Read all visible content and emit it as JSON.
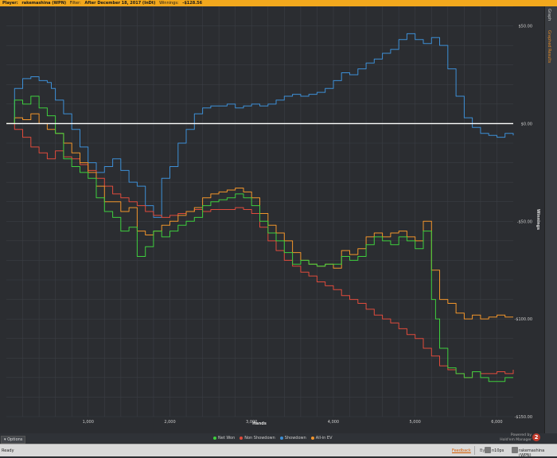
{
  "header": {
    "player_label": "Player:",
    "player_value": "rakemashina (WPN)",
    "filter_label": "Filter:",
    "filter_value": "After December 18, 2017 (InDt)",
    "winnings_label": "Winnings:",
    "winnings_value": "-$128.56"
  },
  "right_panel": {
    "tab1": "Graph",
    "tab2": "Graphed Results"
  },
  "options_label": "Options",
  "brand": {
    "line1": "Powered by",
    "line2": "Hold'em Manager",
    "badge": "2"
  },
  "status": {
    "ready": "Ready",
    "feedback": "Feedback",
    "db_label": "By",
    "user1": "n10ps",
    "user2": "rakemashina (WPN)"
  },
  "colors": {
    "net_won": "#3ecf3e",
    "non_showdown": "#e04b3c",
    "showdown": "#3d8fd6",
    "allin_ev": "#f2952b",
    "background": "#2b2d31",
    "grid": "#3b3e44",
    "zero_line": "#ffffff"
  },
  "chart_data": {
    "type": "line",
    "xlabel": "Hands",
    "ylabel": "Winnings",
    "xlim": [
      0,
      6200
    ],
    "ylim": [
      -150,
      60
    ],
    "x_ticks": [
      1000,
      2000,
      3000,
      4000,
      5000,
      6000
    ],
    "x_tick_labels": [
      "1,000",
      "2,000",
      "3,000",
      "4,000",
      "5,000",
      "6,000"
    ],
    "y_ticks": [
      50,
      0,
      -50,
      -100,
      -150
    ],
    "y_tick_labels": [
      "$50.00",
      "$0.00",
      "-$50.00",
      "-$100.00",
      "-$150.00"
    ],
    "grid": true,
    "legend_position": "bottom",
    "series": [
      {
        "name": "Net Won",
        "color": "#3ecf3e",
        "x": [
          0,
          100,
          200,
          300,
          400,
          500,
          600,
          700,
          800,
          900,
          1000,
          1100,
          1200,
          1300,
          1400,
          1500,
          1600,
          1700,
          1800,
          1900,
          2000,
          2100,
          2200,
          2300,
          2400,
          2500,
          2600,
          2700,
          2800,
          2900,
          3000,
          3100,
          3200,
          3300,
          3400,
          3500,
          3600,
          3700,
          3800,
          3900,
          4000,
          4100,
          4200,
          4300,
          4400,
          4500,
          4600,
          4700,
          4800,
          4900,
          5000,
          5100,
          5200,
          5250,
          5300,
          5400,
          5500,
          5600,
          5700,
          5800,
          5900,
          6000,
          6100,
          6200
        ],
        "y": [
          0,
          12,
          10,
          14,
          8,
          4,
          -5,
          -18,
          -22,
          -25,
          -28,
          -38,
          -45,
          -48,
          -55,
          -53,
          -68,
          -63,
          -55,
          -58,
          -55,
          -52,
          -50,
          -48,
          -42,
          -40,
          -39,
          -38,
          -36,
          -38,
          -42,
          -50,
          -56,
          -60,
          -66,
          -72,
          -70,
          -72,
          -73,
          -72,
          -72,
          -68,
          -70,
          -68,
          -62,
          -58,
          -60,
          -62,
          -58,
          -60,
          -64,
          -55,
          -90,
          -100,
          -115,
          -125,
          -128,
          -130,
          -127,
          -130,
          -132,
          -132,
          -130,
          -130
        ]
      },
      {
        "name": "Non Showdown",
        "color": "#e04b3c",
        "x": [
          0,
          100,
          200,
          300,
          400,
          500,
          600,
          700,
          800,
          900,
          1000,
          1100,
          1200,
          1300,
          1400,
          1500,
          1600,
          1700,
          1800,
          1900,
          2000,
          2100,
          2200,
          2300,
          2400,
          2500,
          2600,
          2700,
          2800,
          2900,
          3000,
          3100,
          3200,
          3300,
          3400,
          3500,
          3600,
          3700,
          3800,
          3900,
          4000,
          4100,
          4200,
          4300,
          4400,
          4500,
          4600,
          4700,
          4800,
          4900,
          5000,
          5100,
          5200,
          5300,
          5400,
          5500,
          5600,
          5700,
          5800,
          5900,
          6000,
          6100,
          6200
        ],
        "y": [
          0,
          -3,
          -7,
          -12,
          -15,
          -18,
          -14,
          -17,
          -18,
          -21,
          -24,
          -28,
          -32,
          -36,
          -38,
          -40,
          -42,
          -45,
          -47,
          -48,
          -47,
          -46,
          -45,
          -44,
          -45,
          -44,
          -44,
          -44,
          -43,
          -44,
          -46,
          -53,
          -60,
          -65,
          -70,
          -73,
          -76,
          -78,
          -81,
          -83,
          -85,
          -88,
          -90,
          -92,
          -95,
          -98,
          -100,
          -102,
          -105,
          -108,
          -110,
          -115,
          -119,
          -124,
          -126,
          -128,
          -130,
          -127,
          -128,
          -128,
          -127,
          -128,
          -126
        ]
      },
      {
        "name": "Showdown",
        "color": "#3d8fd6",
        "x": [
          0,
          100,
          200,
          300,
          400,
          500,
          550,
          600,
          700,
          800,
          900,
          1000,
          1100,
          1200,
          1300,
          1400,
          1500,
          1600,
          1700,
          1800,
          1900,
          2000,
          2100,
          2200,
          2300,
          2400,
          2500,
          2600,
          2700,
          2800,
          2900,
          3000,
          3100,
          3200,
          3300,
          3400,
          3500,
          3600,
          3700,
          3800,
          3900,
          4000,
          4100,
          4200,
          4300,
          4400,
          4500,
          4600,
          4700,
          4800,
          4900,
          5000,
          5100,
          5200,
          5300,
          5400,
          5500,
          5600,
          5700,
          5800,
          5900,
          6000,
          6100,
          6200
        ],
        "y": [
          0,
          18,
          23,
          24,
          22,
          21,
          18,
          12,
          5,
          -3,
          -12,
          -20,
          -25,
          -22,
          -18,
          -24,
          -30,
          -32,
          -42,
          -48,
          -28,
          -22,
          -10,
          -3,
          5,
          8,
          9,
          9,
          10,
          8,
          9,
          10,
          9,
          10,
          12,
          14,
          15,
          14,
          15,
          16,
          18,
          22,
          26,
          25,
          28,
          31,
          33,
          36,
          38,
          43,
          46,
          43,
          41,
          44,
          40,
          28,
          14,
          3,
          -2,
          -5,
          -6,
          -7,
          -5,
          -6
        ]
      },
      {
        "name": "All-in EV",
        "color": "#f2952b",
        "x": [
          0,
          100,
          200,
          300,
          400,
          500,
          600,
          700,
          800,
          900,
          1000,
          1100,
          1200,
          1300,
          1400,
          1500,
          1600,
          1700,
          1800,
          1900,
          2000,
          2100,
          2200,
          2300,
          2400,
          2500,
          2600,
          2700,
          2800,
          2900,
          3000,
          3100,
          3200,
          3300,
          3400,
          3500,
          3600,
          3700,
          3800,
          3900,
          4000,
          4100,
          4200,
          4300,
          4400,
          4500,
          4600,
          4700,
          4800,
          4900,
          5000,
          5100,
          5200,
          5300,
          5400,
          5500,
          5600,
          5700,
          5800,
          5900,
          6000,
          6100,
          6200
        ],
        "y": [
          0,
          3,
          2,
          5,
          0,
          -3,
          -5,
          -10,
          -15,
          -20,
          -25,
          -32,
          -40,
          -40,
          -45,
          -43,
          -55,
          -57,
          -55,
          -52,
          -50,
          -47,
          -45,
          -43,
          -38,
          -36,
          -35,
          -34,
          -33,
          -35,
          -38,
          -46,
          -52,
          -56,
          -60,
          -66,
          -70,
          -72,
          -73,
          -72,
          -74,
          -65,
          -67,
          -64,
          -58,
          -56,
          -58,
          -56,
          -55,
          -58,
          -60,
          -50,
          -75,
          -90,
          -92,
          -97,
          -100,
          -98,
          -100,
          -99,
          -98,
          -99,
          -99
        ]
      }
    ]
  }
}
